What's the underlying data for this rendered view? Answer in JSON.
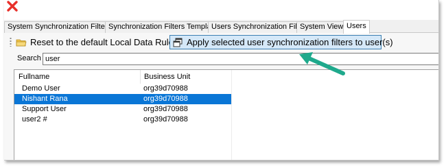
{
  "tabs": [
    {
      "label": "System Synchronization Filters"
    },
    {
      "label": "Synchronization Filters Templates"
    },
    {
      "label": "Users Synchronization Filters"
    },
    {
      "label": "System Views"
    },
    {
      "label": "Users",
      "active": true
    }
  ],
  "toolbar": {
    "reset_label": "Reset to the default Local Data Rules",
    "apply_label": "Apply selected user synchronization filters to user(s)"
  },
  "search": {
    "label": "Search",
    "value": "user"
  },
  "grid": {
    "columns": [
      "Fullname",
      "Business Unit"
    ],
    "rows": [
      {
        "fullname": "Demo User",
        "business_unit": "org39d70988",
        "selected": false
      },
      {
        "fullname": "Nishant Rana",
        "business_unit": "org39d70988",
        "selected": true
      },
      {
        "fullname": "Support User",
        "business_unit": "org39d70988",
        "selected": false
      },
      {
        "fullname": "user2 #",
        "business_unit": "org39d70988",
        "selected": false
      }
    ]
  },
  "colors": {
    "selection": "#0a76d6",
    "apply_button_bg": "#d5e8f8",
    "apply_button_border": "#3c7fb1",
    "annotation_arrow": "#1fa98c",
    "close_icon": "#e8302a"
  },
  "icons": {
    "close": "close-x-icon",
    "reset": "folder-icon",
    "apply": "copy-windows-icon",
    "annotation": "pointer-arrow-icon"
  }
}
